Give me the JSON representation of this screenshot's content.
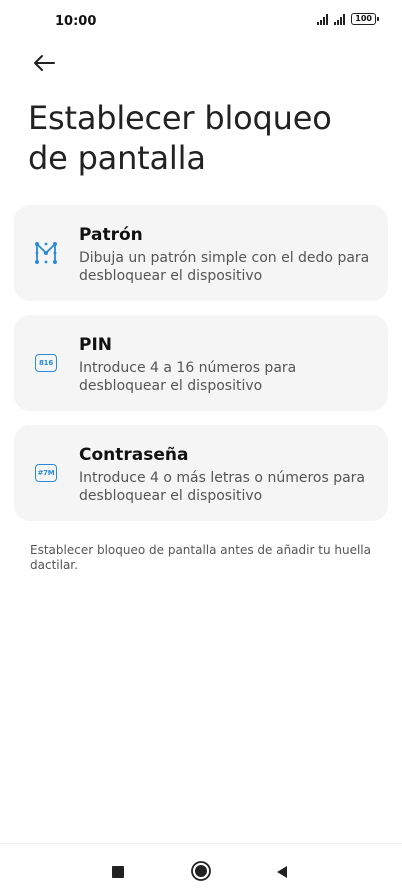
{
  "status_bar": {
    "time": "10:00",
    "battery": "100"
  },
  "page": {
    "title": "Establecer bloqueo de pantalla"
  },
  "options": [
    {
      "title": "Patrón",
      "description": "Dibuja un patrón simple con el dedo para desbloquear el dispositivo",
      "icon": "pattern-icon"
    },
    {
      "title": "PIN",
      "description": "Introduce 4 a 16 números para desbloquear el dispositivo",
      "icon": "pin-icon",
      "icon_text": "816"
    },
    {
      "title": "Contraseña",
      "description": "Introduce 4 o más letras o números para desbloquear el dispositivo",
      "icon": "password-icon",
      "icon_text": "#7M"
    }
  ],
  "footer": {
    "note": "Establecer bloqueo de pantalla antes de añadir tu huella dactilar."
  },
  "colors": {
    "accent": "#2a8bd8",
    "card_background": "#f5f5f5"
  }
}
